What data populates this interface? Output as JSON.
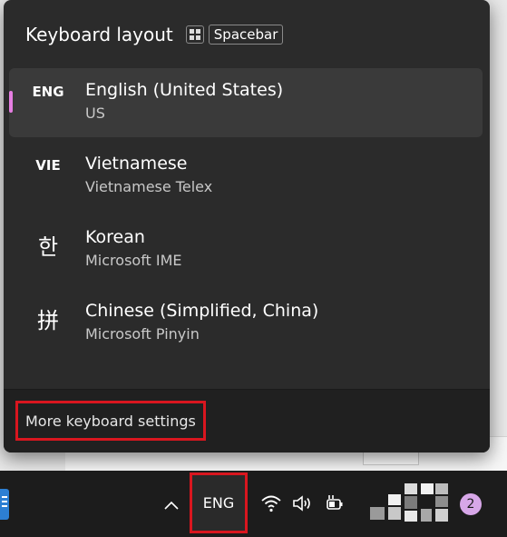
{
  "flyout": {
    "title": "Keyboard layout",
    "shortcut_key_1_icon": "windows-logo-icon",
    "shortcut_key_2": "Spacebar",
    "accent_color": "#e67ee2",
    "languages": [
      {
        "code": "ENG",
        "name": "English (United States)",
        "layout": "US",
        "selected": true
      },
      {
        "code": "VIE",
        "name": "Vietnamese",
        "layout": "Vietnamese Telex",
        "selected": false
      },
      {
        "code": "한",
        "name": "Korean",
        "layout": "Microsoft IME",
        "selected": false
      },
      {
        "code": "拼",
        "name": "Chinese (Simplified, China)",
        "layout": "Microsoft Pinyin",
        "selected": false
      }
    ],
    "more_settings": "More keyboard settings"
  },
  "taskbar": {
    "language_indicator": "ENG",
    "notification_count": "2",
    "icons": [
      "chevron-up-icon",
      "wifi-icon",
      "volume-icon",
      "battery-charging-icon"
    ]
  },
  "highlight_color": "#d9161f"
}
